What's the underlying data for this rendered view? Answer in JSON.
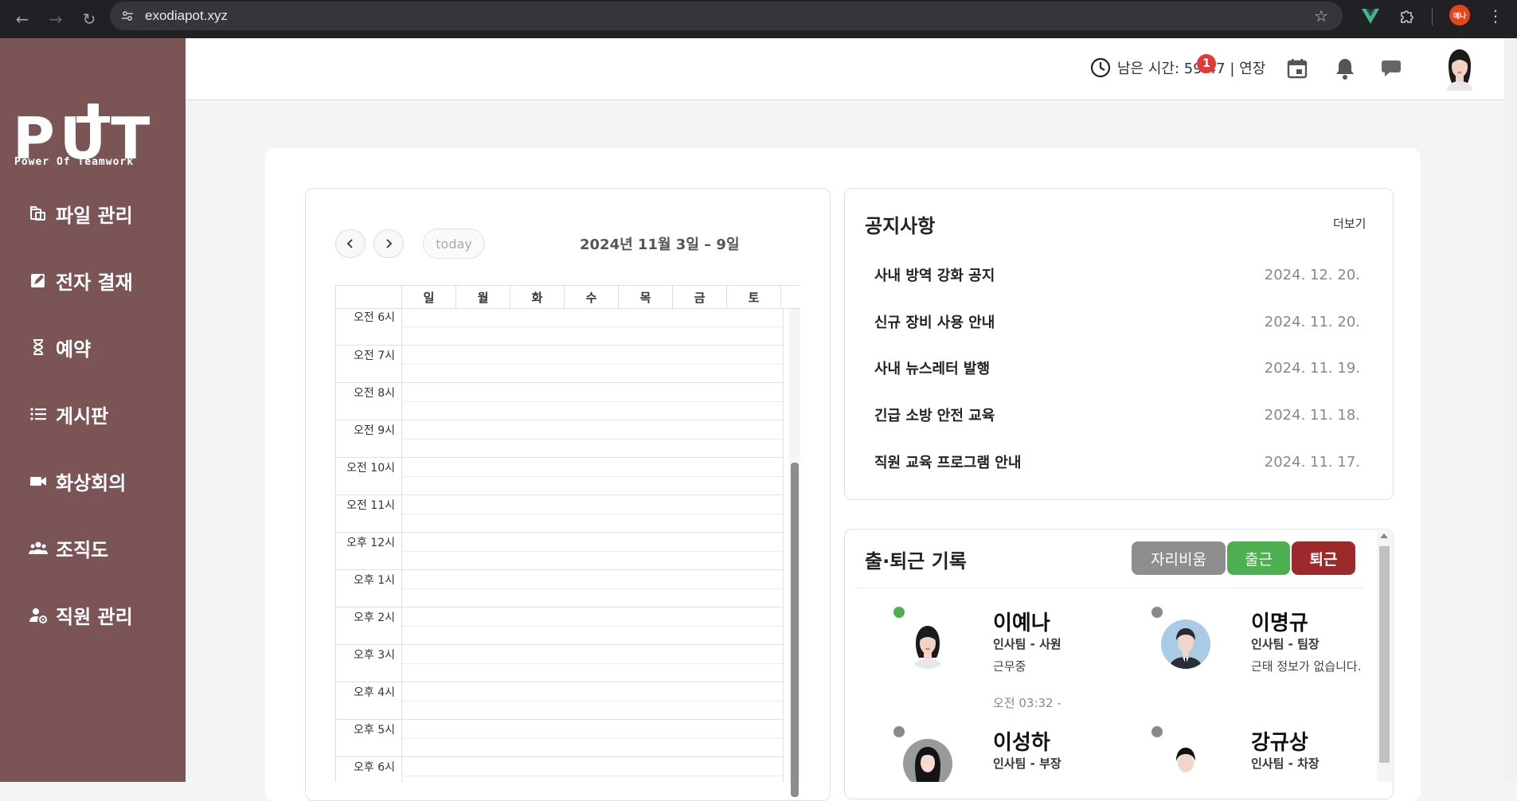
{
  "browser": {
    "url": "exodiapot.xyz",
    "profile_label": "예나"
  },
  "brand": {
    "logo_text": "PUT",
    "tagline": "Power Of Teamwork"
  },
  "sidebar": {
    "items": [
      {
        "label": "파일 관리",
        "icon": "folder-icon"
      },
      {
        "label": "전자 결재",
        "icon": "edit-icon"
      },
      {
        "label": "예약",
        "icon": "hourglass-icon"
      },
      {
        "label": "게시판",
        "icon": "list-icon"
      },
      {
        "label": "화상회의",
        "icon": "video-icon"
      },
      {
        "label": "조직도",
        "icon": "people-icon"
      },
      {
        "label": "직원 관리",
        "icon": "user-gear-icon"
      }
    ]
  },
  "header": {
    "timer_text": "남은 시간: 59:47 | 연장",
    "chat_badge": "1"
  },
  "calendar": {
    "today_label": "today",
    "title": "2024년 11월 3일 – 9일",
    "days": [
      "일",
      "월",
      "화",
      "수",
      "목",
      "금",
      "토"
    ],
    "times": [
      "오전 6시",
      "오전 7시",
      "오전 8시",
      "오전 9시",
      "오전 10시",
      "오전 11시",
      "오후 12시",
      "오후 1시",
      "오후 2시",
      "오후 3시",
      "오후 4시",
      "오후 5시",
      "오후 6시"
    ]
  },
  "notice": {
    "title": "공지사항",
    "more_label": "더보기",
    "items": [
      {
        "title": "사내 방역 강화 공지",
        "date": "2024. 12. 20."
      },
      {
        "title": "신규 장비 사용 안내",
        "date": "2024. 11. 20."
      },
      {
        "title": "사내 뉴스레터 발행",
        "date": "2024. 11. 19."
      },
      {
        "title": "긴급 소방 안전 교육",
        "date": "2024. 11. 18."
      },
      {
        "title": "직원 교육 프로그램 안내",
        "date": "2024. 11. 17."
      }
    ]
  },
  "attendance": {
    "title": "출·퇴근 기록",
    "buttons": {
      "away": "자리비움",
      "clock_in": "출근",
      "clock_out": "퇴근"
    },
    "colors": {
      "away": "#8e8e8e",
      "clock_in": "#4caf50",
      "clock_out": "#9c2a2a",
      "online": "#4caf50",
      "offline": "#8a8a8a"
    },
    "employees": [
      {
        "name": "이예나",
        "role": "인사팀 - 사원",
        "status": "근무중",
        "time": "오전 03:32 -",
        "online": true
      },
      {
        "name": "이명규",
        "role": "인사팀 - 팀장",
        "status": "근태 정보가 없습니다.",
        "time": "",
        "online": false
      },
      {
        "name": "이성하",
        "role": "인사팀 - 부장",
        "status": "",
        "time": "",
        "online": false
      },
      {
        "name": "강규상",
        "role": "인사팀 - 차장",
        "status": "",
        "time": "",
        "online": false
      }
    ]
  },
  "colors": {
    "sidebar": "#7b5455",
    "badge": "#e53935"
  }
}
